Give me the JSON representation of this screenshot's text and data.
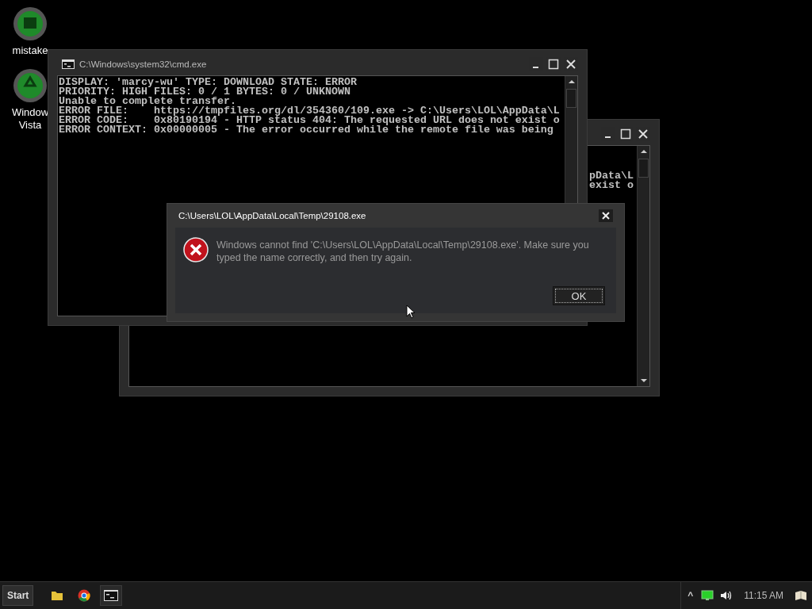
{
  "desktop_icons": [
    {
      "label": "mistake",
      "kind": "app"
    },
    {
      "label": "Window\nVista",
      "kind": "recycle"
    }
  ],
  "back_console": {
    "lines": [
      "pData\\L",
      "exist o"
    ]
  },
  "cmd_window": {
    "title": "C:\\Windows\\system32\\cmd.exe",
    "lines": [
      "DISPLAY: 'marcy-wu' TYPE: DOWNLOAD STATE: ERROR",
      "PRIORITY: HIGH FILES: 0 / 1 BYTES: 0 / UNKNOWN",
      "Unable to complete transfer.",
      "ERROR FILE:    https://tmpfiles.org/dl/354360/109.exe -> C:\\Users\\LOL\\AppData\\L",
      "ERROR CODE:    0x80190194 - HTTP status 404: The requested URL does not exist o",
      "ERROR CONTEXT: 0x00000005 - The error occurred while the remote file was being"
    ]
  },
  "dialog": {
    "title": "C:\\Users\\LOL\\AppData\\Local\\Temp\\29108.exe",
    "message": "Windows cannot find 'C:\\Users\\LOL\\AppData\\Local\\Temp\\29108.exe'. Make sure you typed the name correctly, and then try again.",
    "button": "OK"
  },
  "taskbar": {
    "start": "Start",
    "chevron": "^",
    "time": "11:15 AM"
  }
}
